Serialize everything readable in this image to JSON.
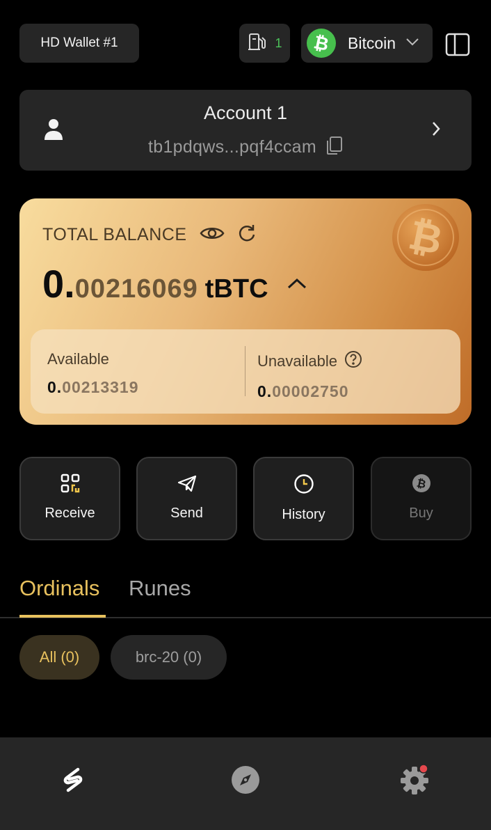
{
  "header": {
    "wallet_label": "HD Wallet #1",
    "gas_count": "1",
    "chain_name": "Bitcoin"
  },
  "account": {
    "name": "Account 1",
    "address": "tb1pdqws...pqf4ccam"
  },
  "balance": {
    "label": "TOTAL BALANCE",
    "integer_part": "0.",
    "decimal_part": "00216069",
    "unit": "tBTC",
    "available": {
      "label": "Available",
      "integer_part": "0.",
      "decimal_part": "00213319"
    },
    "unavailable": {
      "label": "Unavailable",
      "integer_part": "0.",
      "decimal_part": "00002750"
    }
  },
  "actions": [
    {
      "label": "Receive",
      "icon": "qr-code-icon",
      "enabled": true
    },
    {
      "label": "Send",
      "icon": "paper-plane-icon",
      "enabled": true
    },
    {
      "label": "History",
      "icon": "clock-icon",
      "enabled": true
    },
    {
      "label": "Buy",
      "icon": "bitcoin-coin-icon",
      "enabled": false
    }
  ],
  "tabs": [
    {
      "label": "Ordinals",
      "active": true
    },
    {
      "label": "Runes",
      "active": false
    }
  ],
  "filters": [
    {
      "label": "All (0)",
      "active": true
    },
    {
      "label": "brc-20 (0)",
      "active": false
    }
  ],
  "bottom_nav": [
    {
      "icon": "wallet-logo-icon",
      "active": true
    },
    {
      "icon": "compass-icon",
      "active": false
    },
    {
      "icon": "settings-gear-icon",
      "active": false,
      "notification_dot": true
    }
  ],
  "colors": {
    "accent": "#e8c15e",
    "bitcoin_green": "#47bf4d",
    "card_bg": "#262626",
    "notification": "#e5484d"
  }
}
